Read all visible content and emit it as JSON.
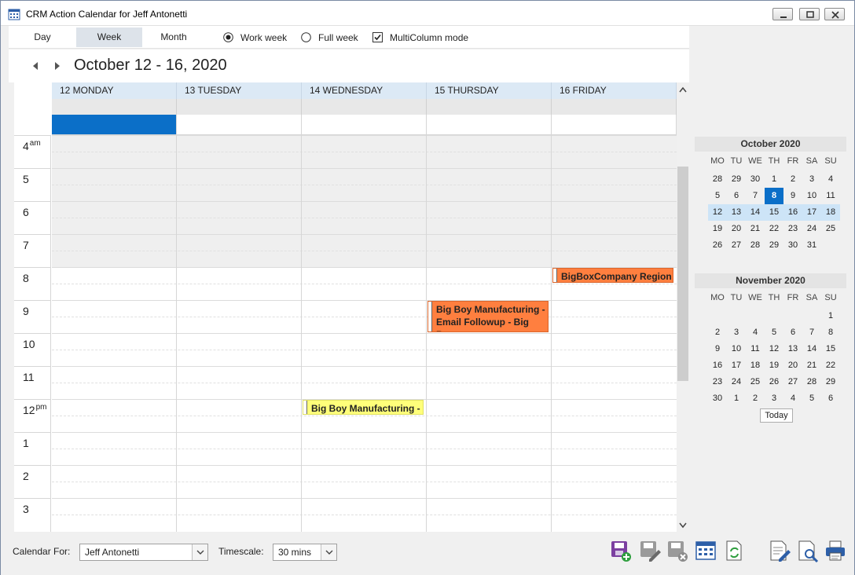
{
  "window": {
    "title": "CRM Action Calendar for Jeff Antonetti"
  },
  "view_tabs": {
    "day": "Day",
    "week": "Week",
    "month": "Month"
  },
  "options": {
    "work_week": "Work week",
    "full_week": "Full week",
    "multicolumn": "MultiColumn mode",
    "selected": "Work week",
    "multicolumn_checked": true
  },
  "range_title": "October 12 - 16, 2020",
  "days": [
    "12 MONDAY",
    "13 TUESDAY",
    "14 WEDNESDAY",
    "15 THURSDAY",
    "16 FRIDAY"
  ],
  "hours": [
    {
      "h": "4",
      "suffix": "am"
    },
    {
      "h": "5",
      "suffix": ""
    },
    {
      "h": "6",
      "suffix": ""
    },
    {
      "h": "7",
      "suffix": ""
    },
    {
      "h": "8",
      "suffix": ""
    },
    {
      "h": "9",
      "suffix": ""
    },
    {
      "h": "10",
      "suffix": ""
    },
    {
      "h": "11",
      "suffix": ""
    },
    {
      "h": "12",
      "suffix": "pm"
    },
    {
      "h": "1",
      "suffix": ""
    },
    {
      "h": "2",
      "suffix": ""
    },
    {
      "h": "3",
      "suffix": ""
    }
  ],
  "events": [
    {
      "day": 4,
      "start": "8:00",
      "label": "BigBoxCompany Region",
      "color": "#ff7f3f"
    },
    {
      "day": 3,
      "start": "9:00",
      "label": "Big Boy Manufacturing -\nEmail Followup - Big Boy",
      "color": "#ff7f3f"
    },
    {
      "day": 2,
      "start": "12:00",
      "label": "Big Boy Manufacturing -",
      "color": "#ffff7a"
    }
  ],
  "mini_calendars": [
    {
      "title": "October 2020",
      "dow": [
        "MO",
        "TU",
        "WE",
        "TH",
        "FR",
        "SA",
        "SU"
      ],
      "weeks": [
        [
          "28",
          "29",
          "30",
          "1",
          "2",
          "3",
          "4"
        ],
        [
          "5",
          "6",
          "7",
          "8",
          "9",
          "10",
          "11"
        ],
        [
          "12",
          "13",
          "14",
          "15",
          "16",
          "17",
          "18"
        ],
        [
          "19",
          "20",
          "21",
          "22",
          "23",
          "24",
          "25"
        ],
        [
          "26",
          "27",
          "28",
          "29",
          "30",
          "31",
          ""
        ]
      ],
      "today": "8",
      "selected_week": 2
    },
    {
      "title": "November 2020",
      "dow": [
        "MO",
        "TU",
        "WE",
        "TH",
        "FR",
        "SA",
        "SU"
      ],
      "weeks": [
        [
          "",
          "",
          "",
          "",
          "",
          "",
          "1"
        ],
        [
          "2",
          "3",
          "4",
          "5",
          "6",
          "7",
          "8"
        ],
        [
          "9",
          "10",
          "11",
          "12",
          "13",
          "14",
          "15"
        ],
        [
          "16",
          "17",
          "18",
          "19",
          "20",
          "21",
          "22"
        ],
        [
          "23",
          "24",
          "25",
          "26",
          "27",
          "28",
          "29"
        ],
        [
          "30",
          "1",
          "2",
          "3",
          "4",
          "5",
          "6"
        ]
      ]
    }
  ],
  "today_button": "Today",
  "footer": {
    "calendar_for_label": "Calendar For:",
    "calendar_for_value": "Jeff Antonetti",
    "timescale_label": "Timescale:",
    "timescale_value": "30 mins"
  },
  "toolbar_icons": [
    "new-activity-icon",
    "edit-activity-icon",
    "delete-activity-icon",
    "calendar-icon",
    "refresh-icon",
    "notes-icon",
    "preview-icon",
    "print-icon"
  ]
}
